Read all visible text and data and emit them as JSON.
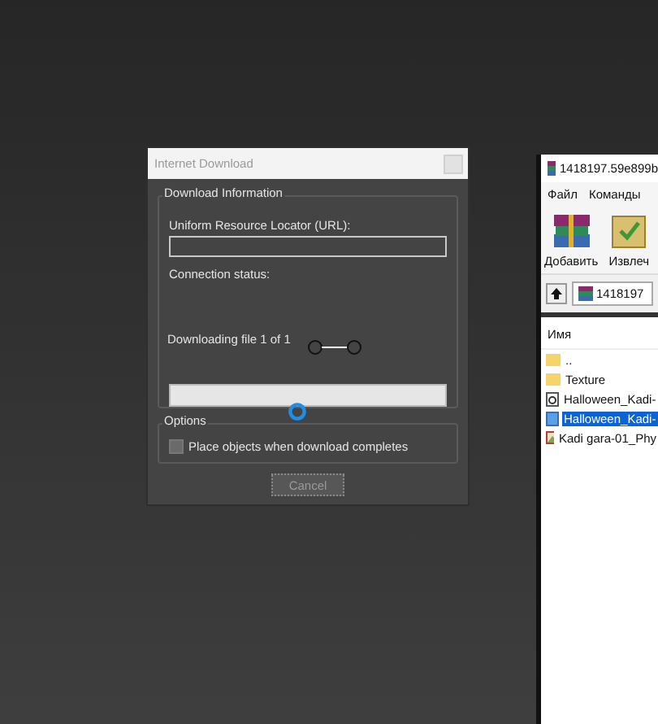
{
  "dialog": {
    "title": "Internet Download",
    "info_group": {
      "title": "Download Information",
      "url_label": "Uniform Resource Locator (URL):",
      "status_label": "Connection status:",
      "progress_text": "Downloading file 1 of 1",
      "progress": {
        "level": 0
      }
    },
    "options_group": {
      "title": "Options",
      "checkbox": {
        "label": "Place objects when download completes",
        "checked": false
      }
    },
    "buttons": [
      {
        "label": "Cancel",
        "disabled": true
      }
    ]
  },
  "archiver": {
    "title": "1418197.59e899b",
    "menu": [
      "Файл",
      "Команды"
    ],
    "toolbar": [
      {
        "label": "Добавить",
        "kind": "add"
      },
      {
        "label": "Извлеч",
        "kind": "extract"
      }
    ],
    "path": "1418197",
    "list": {
      "columns": [
        "Имя"
      ],
      "rows": [
        {
          "name": "..",
          "kind": "folder",
          "selected": false
        },
        {
          "name": "Texture",
          "kind": "folder",
          "selected": false
        },
        {
          "name": "Halloween_Kadi-",
          "kind": "script",
          "selected": false
        },
        {
          "name": "Halloween_Kadi-",
          "kind": "model",
          "selected": true
        },
        {
          "name": "Kadi gara-01_Phy",
          "kind": "image",
          "selected": false
        }
      ]
    }
  }
}
